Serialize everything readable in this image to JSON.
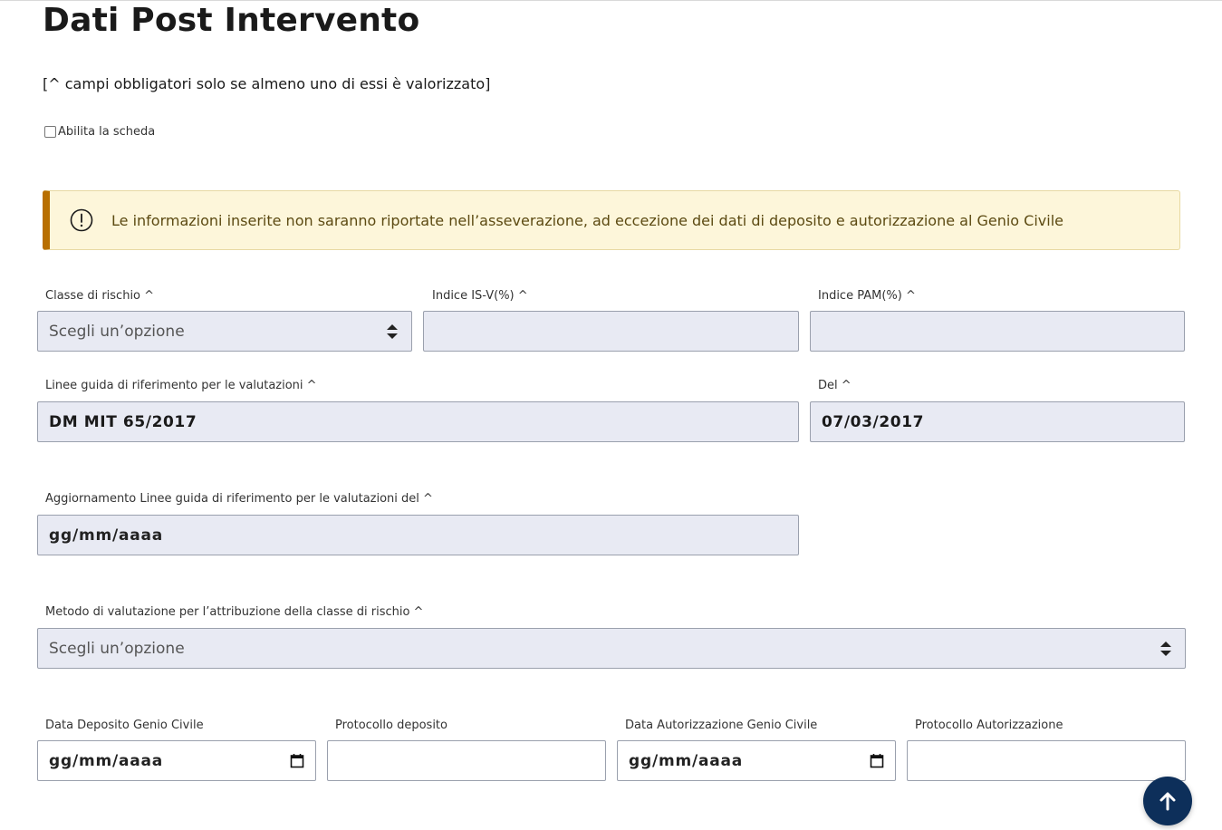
{
  "header": {
    "title": "Dati Post Intervento",
    "subtitle": "[^ campi obbligatori solo se almeno uno di essi è valorizzato]"
  },
  "enable": {
    "label": "Abilita la scheda",
    "checked": false
  },
  "alert": {
    "text": "Le informazioni inserite non saranno riportate nell’asseverazione, ad eccezione dei dati di deposito e autorizzazione al Genio Civile",
    "icon": "exclamation-circle-icon"
  },
  "form": {
    "classe_rischio": {
      "label": "Classe di rischio ^",
      "placeholder": "Scegli un’opzione"
    },
    "indice_isv": {
      "label": "Indice IS-V(%) ^",
      "value": ""
    },
    "indice_pam": {
      "label": "Indice PAM(%) ^",
      "value": ""
    },
    "linee_guida": {
      "label": "Linee guida di riferimento per le valutazioni ^",
      "value": "DM MIT 65/2017"
    },
    "del": {
      "label": "Del ^",
      "value": "07/03/2017"
    },
    "aggiornamento": {
      "label": "Aggiornamento Linee guida di riferimento per le valutazioni del ^",
      "value": "gg/mm/aaaa"
    },
    "metodo": {
      "label": "Metodo di valutazione per l’attribuzione della classe di rischio ^",
      "placeholder": "Scegli un’opzione"
    },
    "data_deposito": {
      "label": "Data Deposito Genio Civile",
      "value": "gg/mm/aaaa"
    },
    "protocollo_deposito": {
      "label": "Protocollo deposito",
      "value": ""
    },
    "data_autorizzazione": {
      "label": "Data Autorizzazione Genio Civile",
      "value": "gg/mm/aaaa"
    },
    "protocollo_autorizzazione": {
      "label": "Protocollo Autorizzazione",
      "value": ""
    }
  },
  "scroll_top": {
    "icon": "arrow-up-icon"
  },
  "colors": {
    "alert_bg": "#fdf6da",
    "alert_accent": "#b86f00",
    "field_bg": "#e8eaf3",
    "scroll_button": "#0d2f5a"
  }
}
